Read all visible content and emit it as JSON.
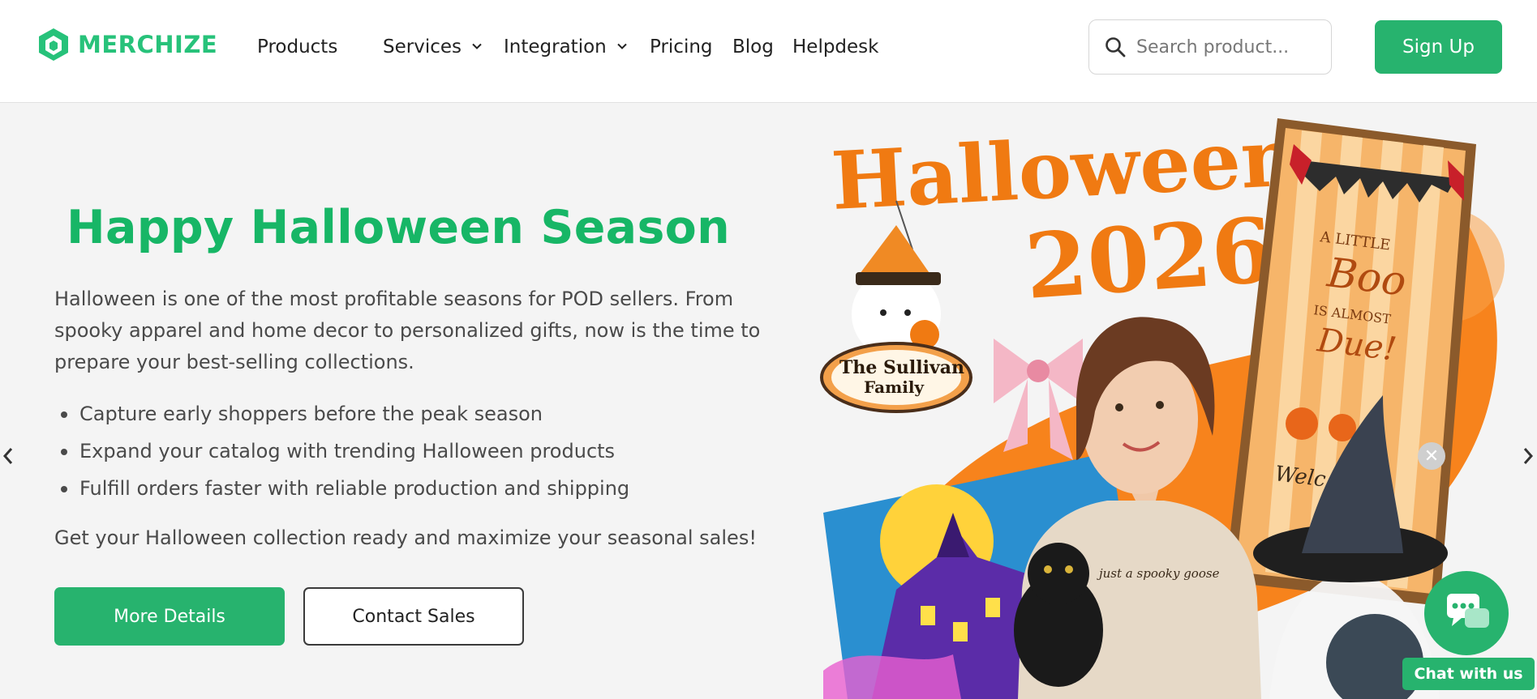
{
  "brand": {
    "name": "MERCHIZE",
    "color": "#27c27a"
  },
  "nav": {
    "items": [
      {
        "label": "Products",
        "has_dropdown": false
      },
      {
        "label": "Services",
        "has_dropdown": true
      },
      {
        "label": "Integration",
        "has_dropdown": true
      },
      {
        "label": "Pricing",
        "has_dropdown": false
      },
      {
        "label": "Blog",
        "has_dropdown": false
      },
      {
        "label": "Helpdesk",
        "has_dropdown": false
      }
    ],
    "search": {
      "placeholder": "Search product..."
    },
    "signup_label": "Sign Up"
  },
  "hero": {
    "title": "Happy Halloween Season",
    "description": "Halloween is one of the most profitable seasons for POD sellers. From spooky apparel and home decor to personalized gifts, now is the time to prepare your best-selling collections.",
    "bullets": [
      "Capture early shoppers before the peak season",
      "Expand your catalog with trending Halloween products",
      "Fulfill orders faster with reliable production and shipping"
    ],
    "cta_text": "Get your Halloween collection ready and maximize your seasonal sales!",
    "primary_button": "More Details",
    "secondary_button": "Contact Sales",
    "image_text": {
      "headline_1": "Halloween",
      "headline_2": "2026",
      "plaque_1": "The Sullivan",
      "plaque_2": "Family",
      "banner_1": "A LITTLE",
      "banner_2": "Boo",
      "banner_3": "IS ALMOST",
      "banner_4": "Due!",
      "banner_5": "Welc",
      "shirt": "just a spooky goose"
    }
  },
  "chat": {
    "label": "Chat with us",
    "close_symbol": "✕"
  },
  "colors": {
    "accent": "#27b36e",
    "title_green": "#17b666",
    "halloween_orange": "#f07a12"
  }
}
